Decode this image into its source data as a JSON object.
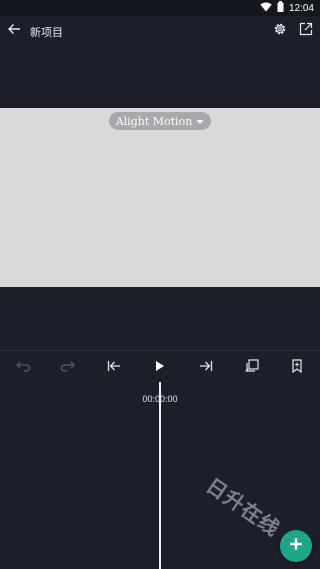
{
  "status_bar": {
    "time": "12:04",
    "icons": [
      "wifi-icon",
      "battery-icon"
    ]
  },
  "app_bar": {
    "title": "新项目",
    "back_icon": "arrow-left-icon",
    "settings_icon": "gear-icon",
    "export_icon": "share-external-icon"
  },
  "preview": {
    "watermark_label": "Alight Motion",
    "watermark_dropdown_icon": "caret-down-icon",
    "canvas_color": "#d9d9d9"
  },
  "toolbar": {
    "tools": [
      {
        "name": "undo-icon",
        "enabled": false
      },
      {
        "name": "redo-icon",
        "enabled": false
      },
      {
        "name": "skip-to-start-icon",
        "enabled": true
      },
      {
        "name": "play-icon",
        "enabled": true
      },
      {
        "name": "skip-to-end-icon",
        "enabled": true
      },
      {
        "name": "copy-layer-icon",
        "enabled": true
      },
      {
        "name": "bookmark-icon",
        "enabled": true
      }
    ]
  },
  "timeline": {
    "timecode": "00:00:00"
  },
  "overlay": {
    "text": "日升在线"
  },
  "fab": {
    "icon": "plus-icon",
    "color": "#1ea58a"
  },
  "colors": {
    "background": "#1c1e2a",
    "status_bar": "#15171f",
    "accent": "#1ea58a",
    "disabled_icon": "#5a5e6e",
    "icon": "#e6e7ec"
  }
}
